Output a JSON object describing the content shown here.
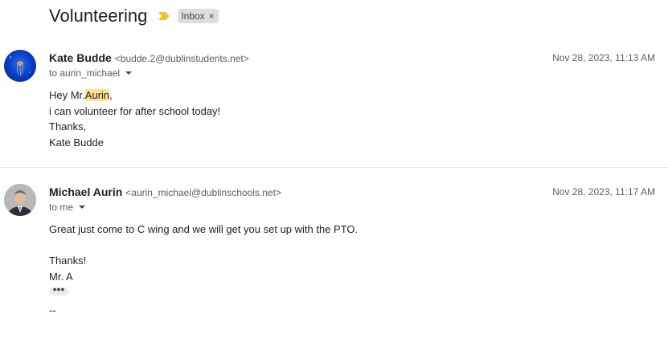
{
  "thread": {
    "subject": "Volunteering",
    "label": "Inbox",
    "label_remove": "×",
    "importance_color": "#f2c12e"
  },
  "messages": [
    {
      "sender_name": "Kate Budde",
      "sender_email": "<budde.2@dublinstudents.net>",
      "date": "Nov 28, 2023, 11:13 AM",
      "to": "to aurin_michael",
      "body": {
        "greeting_prefix": "Hey Mr.",
        "greeting_highlight": "Aurin",
        "greeting_suffix": ",",
        "line2": "i can volunteer for after school today!",
        "line3": "Thanks,",
        "line4": "Kate Budde"
      },
      "avatar": "jellyfish-photo"
    },
    {
      "sender_name": "Michael Aurin",
      "sender_email": "<aurin_michael@dublinschools.net>",
      "date": "Nov 28, 2023, 11:17 AM",
      "to": "to me",
      "body": {
        "line1": "Great just come to C wing and we will get you set up with the PTO.",
        "line2": "Thanks!",
        "line3": "Mr. A",
        "more": "•••",
        "signature_sep": "--"
      },
      "avatar": "profile-photo"
    }
  ],
  "colors": {
    "highlight": "#fde293",
    "chip_bg": "#dddddd",
    "divider": "#e6e6e6"
  }
}
